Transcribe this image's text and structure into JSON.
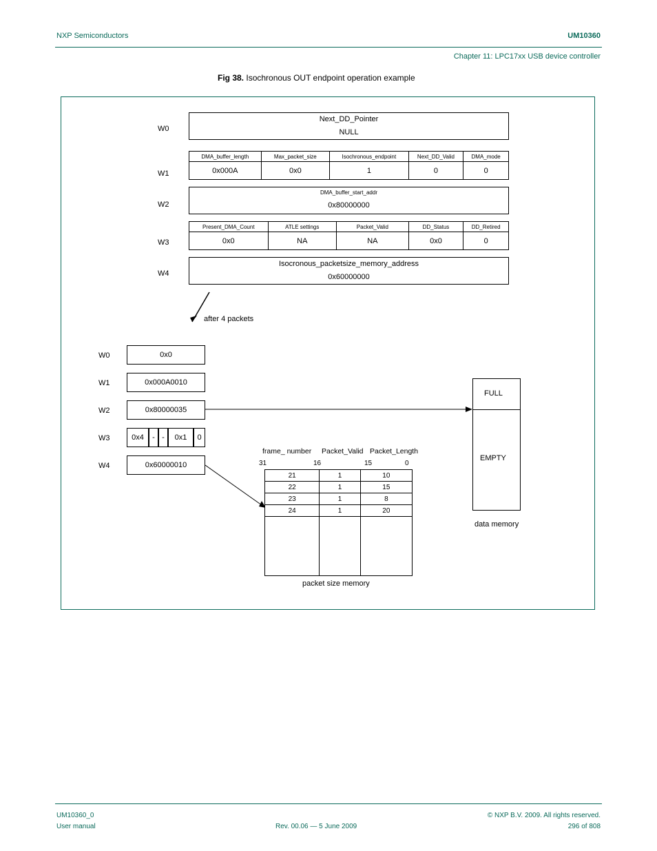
{
  "header": {
    "left": "NXP Semiconductors",
    "right": "UM10360",
    "subtitle": "Chapter 11: LPC17xx USB device controller"
  },
  "footer": {
    "left": "UM10360_0",
    "right": "© NXP B.V. 2009. All rights reserved.",
    "line2_left": "User manual",
    "line2_center": "Rev. 00.06 — 5 June 2009",
    "line2_right": "296 of 808"
  },
  "caption": {
    "fignum": "Fig 38.",
    "text": "Isochronous OUT endpoint operation example"
  },
  "wlabels_a": [
    "W0",
    "W1",
    "W2",
    "W3",
    "W4"
  ],
  "dd": {
    "w0": {
      "title": "Next_DD_Pointer",
      "value": "NULL"
    },
    "w1": {
      "heads": [
        "DMA_buffer_length",
        "Max_packet_size",
        "Isochronous_endpoint",
        "Next_DD_Valid",
        "DMA_mode"
      ],
      "vals": [
        "0x000A",
        "0x0",
        "1",
        "0",
        "0"
      ]
    },
    "w2": {
      "title": "DMA_buffer_start_addr",
      "value": "0x80000000"
    },
    "w3": {
      "heads": [
        "Present_DMA_Count",
        "ATLE settings",
        "Packet_Valid",
        "DD_Status",
        "DD_Retired"
      ],
      "vals": [
        "0x0",
        "NA",
        "NA",
        "0x0",
        "0"
      ]
    },
    "w4": {
      "title": "Isocronous_packetsize_memory_address",
      "value": "0x60000000"
    }
  },
  "arrow_note": "after 4 packets",
  "wlabels_b": [
    "W0",
    "W1",
    "W2",
    "W3",
    "W4"
  ],
  "after": {
    "w0": "0x0",
    "w1": "0x000A0010",
    "w2": "0x80000035",
    "w3": [
      "0x4",
      "-",
      "-",
      "0x1",
      "0"
    ],
    "w4": "0x60000010"
  },
  "packet_table": {
    "cols": [
      "frame_ number",
      "Packet_Valid",
      "Packet_Length"
    ],
    "bits": [
      "31",
      "16",
      "15",
      "0"
    ],
    "rows": [
      [
        "21",
        "1",
        "10"
      ],
      [
        "22",
        "1",
        "15"
      ],
      [
        "23",
        "1",
        "8"
      ],
      [
        "24",
        "1",
        "20"
      ]
    ],
    "caption": "packet size memory"
  },
  "memory": {
    "full": "FULL",
    "empty": "EMPTY",
    "caption": "data memory"
  },
  "chart_data": {
    "type": "table",
    "title": "Isochronous OUT endpoint DMA descriptor example",
    "descriptor_before": {
      "W0": {
        "Next_DD_Pointer": "NULL"
      },
      "W1": {
        "DMA_buffer_length": "0x000A",
        "Max_packet_size": "0x0",
        "Isochronous_endpoint": 1,
        "Next_DD_Valid": 0,
        "DMA_mode": 0
      },
      "W2": {
        "DMA_buffer_start_addr": "0x80000000"
      },
      "W3": {
        "Present_DMA_Count": "0x0",
        "ATLE_settings": "NA",
        "Packet_Valid": "NA",
        "DD_Status": "0x0",
        "DD_Retired": 0
      },
      "W4": {
        "Isochronous_packetsize_memory_address": "0x60000000"
      }
    },
    "descriptor_after_4_packets": {
      "W0": "0x0",
      "W1": "0x000A0010",
      "W2": "0x80000035",
      "W3": {
        "Present_DMA_Count": "0x4",
        "ATLE1": "-",
        "ATLE2": "-",
        "DD_Status": "0x1",
        "DD_Retired": 0
      },
      "W4": "0x60000010"
    },
    "packet_size_memory": {
      "columns": [
        "frame_number",
        "Packet_Valid",
        "Packet_Length"
      ],
      "bit_ranges": {
        "frame_number": "31..16",
        "Packet_Valid": "15",
        "Packet_Length": "14..0"
      },
      "rows": [
        {
          "frame_number": 21,
          "Packet_Valid": 1,
          "Packet_Length": 10
        },
        {
          "frame_number": 22,
          "Packet_Valid": 1,
          "Packet_Length": 15
        },
        {
          "frame_number": 23,
          "Packet_Valid": 1,
          "Packet_Length": 8
        },
        {
          "frame_number": 24,
          "Packet_Valid": 1,
          "Packet_Length": 20
        }
      ]
    },
    "data_memory": {
      "state_top": "FULL",
      "state_bottom": "EMPTY"
    }
  }
}
